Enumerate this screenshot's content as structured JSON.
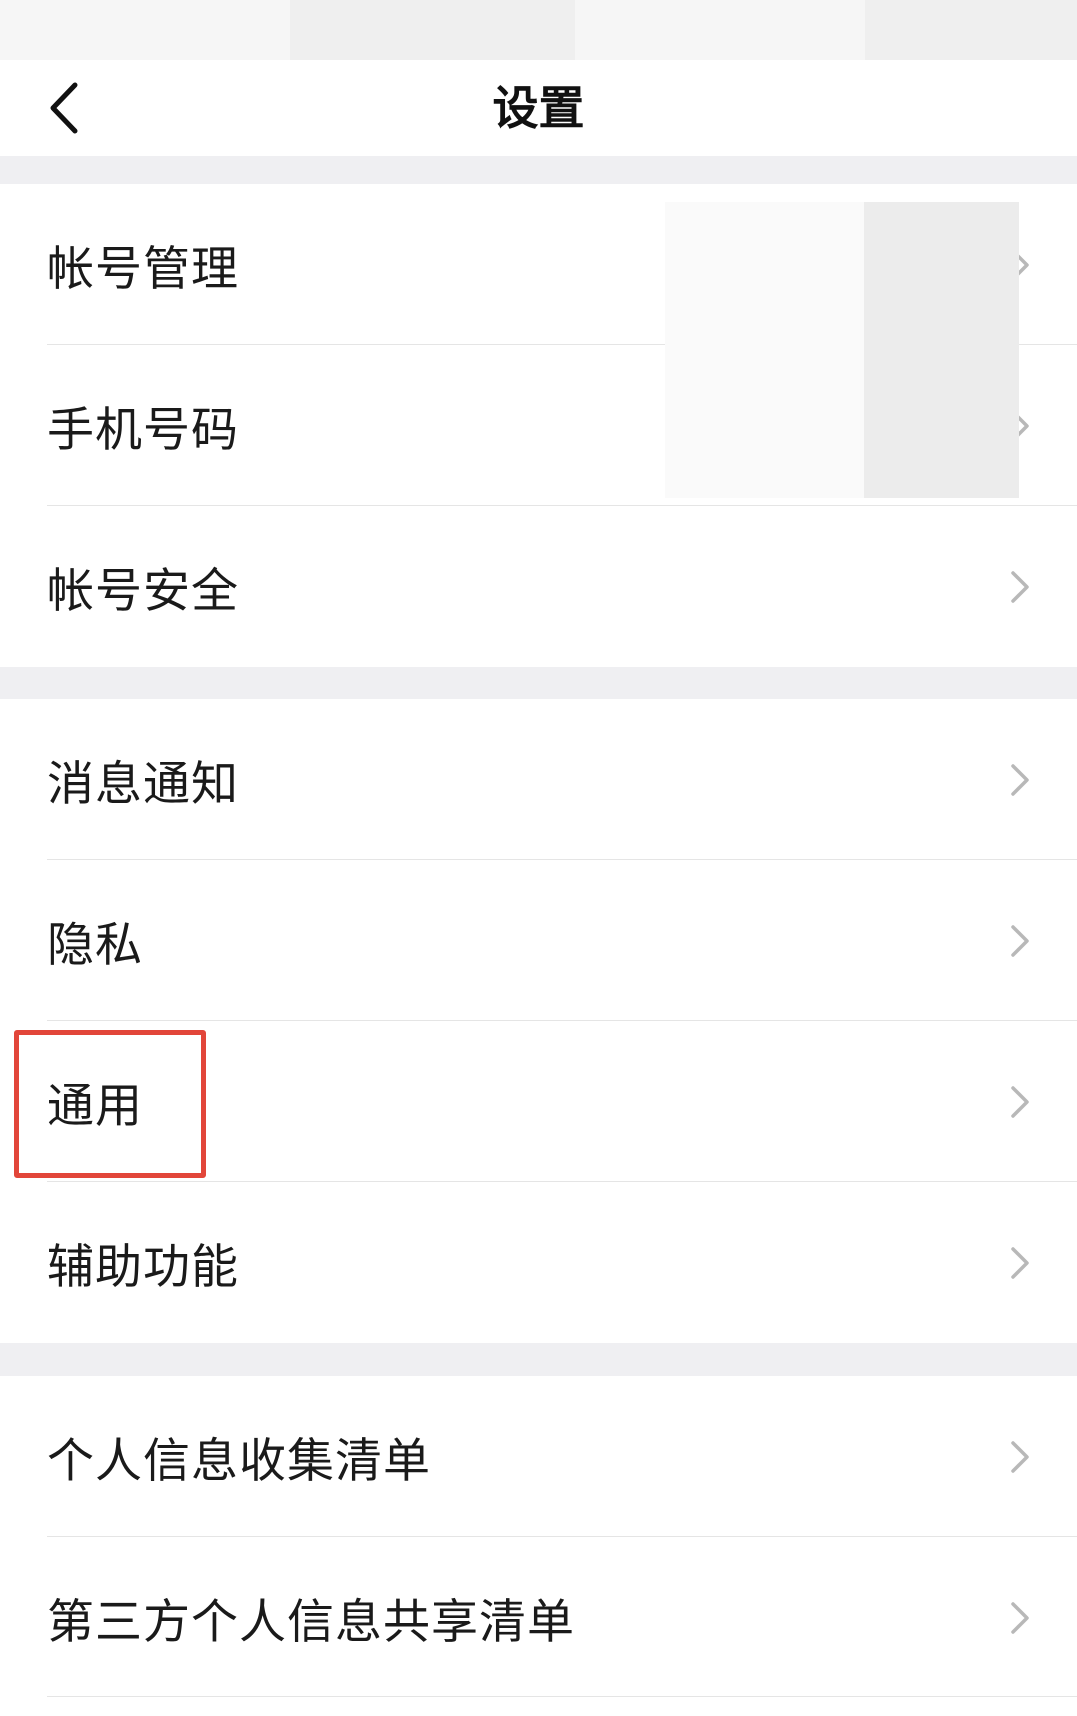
{
  "header": {
    "title": "设置",
    "back_icon": "chevron-left-icon"
  },
  "groups": [
    {
      "items": [
        {
          "label": "帐号管理"
        },
        {
          "label": "手机号码"
        },
        {
          "label": "帐号安全"
        }
      ]
    },
    {
      "items": [
        {
          "label": "消息通知"
        },
        {
          "label": "隐私"
        },
        {
          "label": "通用",
          "highlighted": true
        },
        {
          "label": "辅助功能"
        }
      ]
    },
    {
      "items": [
        {
          "label": "个人信息收集清单"
        },
        {
          "label": "第三方个人信息共享清单"
        }
      ]
    }
  ],
  "colors": {
    "highlight": "#e2463a",
    "group_gap": "#efeff2",
    "chevron": "#b8b8b8"
  }
}
